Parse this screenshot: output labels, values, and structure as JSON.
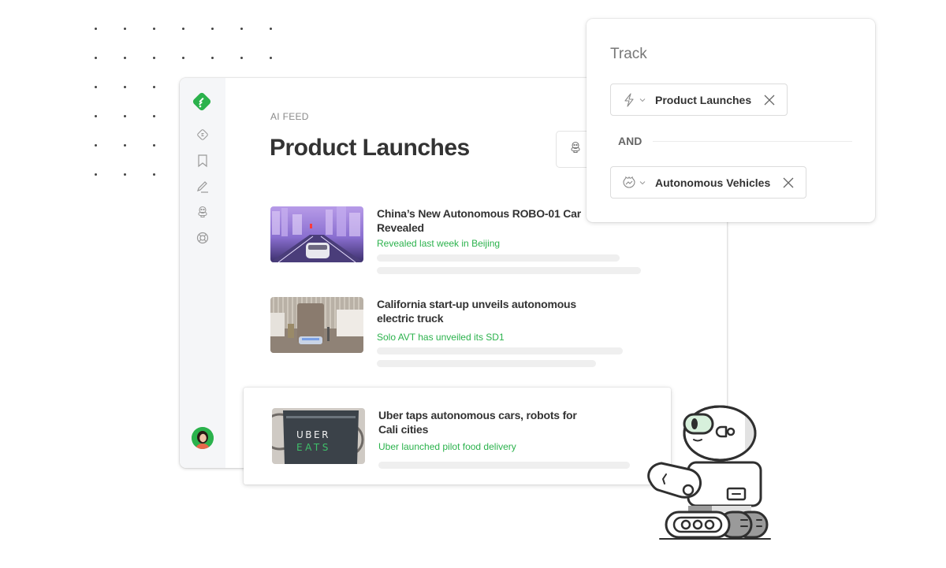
{
  "background": {
    "dot_color": "#444444",
    "dot_rows": 6
  },
  "sidebar": {
    "logo": "feedly-logo-icon",
    "items": [
      {
        "name": "sidebar-item-today",
        "icon": "diamond-badge-icon"
      },
      {
        "name": "sidebar-item-saved",
        "icon": "bookmark-icon"
      },
      {
        "name": "sidebar-item-notes",
        "icon": "pencil-icon"
      },
      {
        "name": "sidebar-item-ai",
        "icon": "robot-icon"
      },
      {
        "name": "sidebar-item-help",
        "icon": "lifebuoy-icon"
      }
    ],
    "avatar": "user-avatar"
  },
  "header": {
    "eyebrow": "AI FEED",
    "title": "Product Launches",
    "action_icon": "robot-icon"
  },
  "articles": [
    {
      "title": "China’s New Autonomous ROBO-01 Car Revealed",
      "subtitle": "Revealed last week in Beijing",
      "thumbnail": "futuristic-car-city"
    },
    {
      "title": "California start-up unveils autonomous electric truck",
      "subtitle": "Solo AVT has unveiled its SD1",
      "thumbnail": "electric-truck-depot"
    },
    {
      "title": "Uber taps autonomous cars, robots for Cali cities",
      "subtitle": "Uber launched pilot food delivery",
      "thumbnail": "uber-eats-bag",
      "thumb_text_1": "UBER",
      "thumb_text_2": "EATS"
    }
  ],
  "track": {
    "title": "Track",
    "operator": "AND",
    "filters": [
      {
        "label": "Product Launches",
        "icon": "lightning-icon"
      },
      {
        "label": "Autonomous Vehicles",
        "icon": "trend-badge-icon"
      }
    ]
  },
  "colors": {
    "accent": "#2bb24c",
    "text": "#333333",
    "muted": "#8a8a8a",
    "sidebar_bg": "#f5f6f8",
    "skeleton": "#efefef",
    "robot_visor": "#d7f0dc"
  }
}
